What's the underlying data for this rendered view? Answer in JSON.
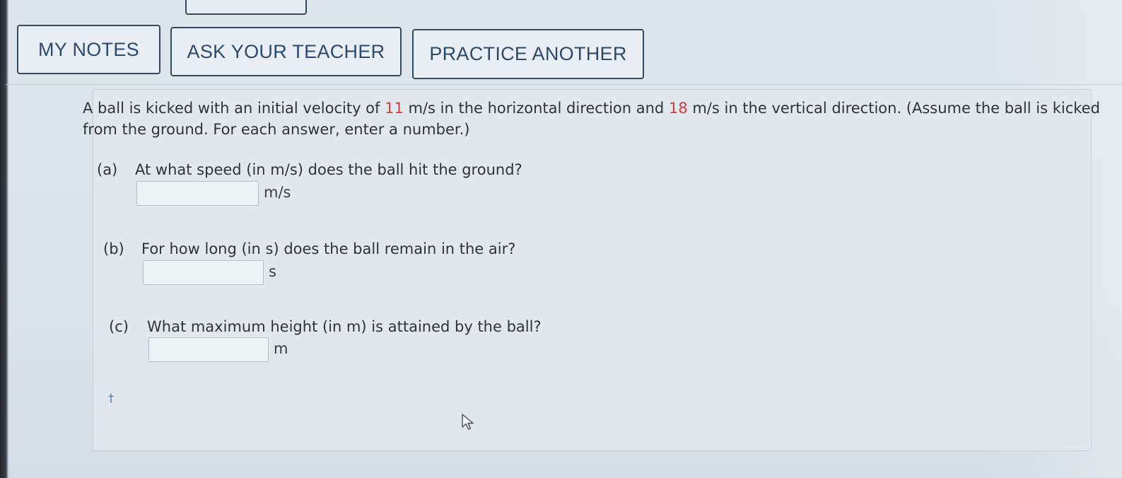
{
  "toolbar": {
    "my_notes": "MY NOTES",
    "ask_teacher": "ASK YOUR TEACHER",
    "practice_another": "PRACTICE ANOTHER"
  },
  "question": {
    "text_1": "A ball is kicked with an initial velocity of ",
    "value_horizontal": "11",
    "text_2": " m/s in the horizontal direction and ",
    "value_vertical": "18",
    "text_3": " m/s in the vertical direction. (Assume the ball is kicked from the ground. For each answer, enter a number.)"
  },
  "parts": [
    {
      "label": "(a)",
      "text": "At what speed (in m/s) does the ball hit the ground?",
      "unit": "m/s",
      "value": ""
    },
    {
      "label": "(b)",
      "text": "For how long (in s) does the ball remain in the air?",
      "unit": "s",
      "value": ""
    },
    {
      "label": "(c)",
      "text": "What maximum height (in m) is attained by the ball?",
      "unit": "m",
      "value": ""
    }
  ],
  "footnote": "†"
}
